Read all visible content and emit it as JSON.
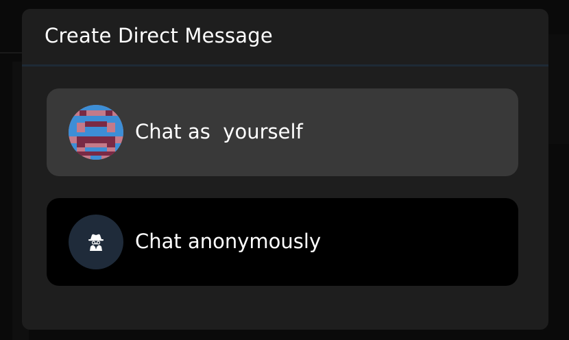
{
  "dialog": {
    "title": "Create Direct Message"
  },
  "options": [
    {
      "label": "Chat as  yourself",
      "avatar": "pixel-identicon-avatar"
    },
    {
      "label": "Chat anonymously",
      "icon": "incognito-spy-icon"
    }
  ],
  "colors": {
    "dialog_background": "#1e1e1e",
    "option_self_background": "#393939",
    "option_anon_background": "#000000",
    "anon_avatar_background": "#1f2b3a",
    "identicon_pink": "#c47a8a",
    "identicon_blue": "#3d8ed6",
    "identicon_maroon": "#7a2a45"
  }
}
